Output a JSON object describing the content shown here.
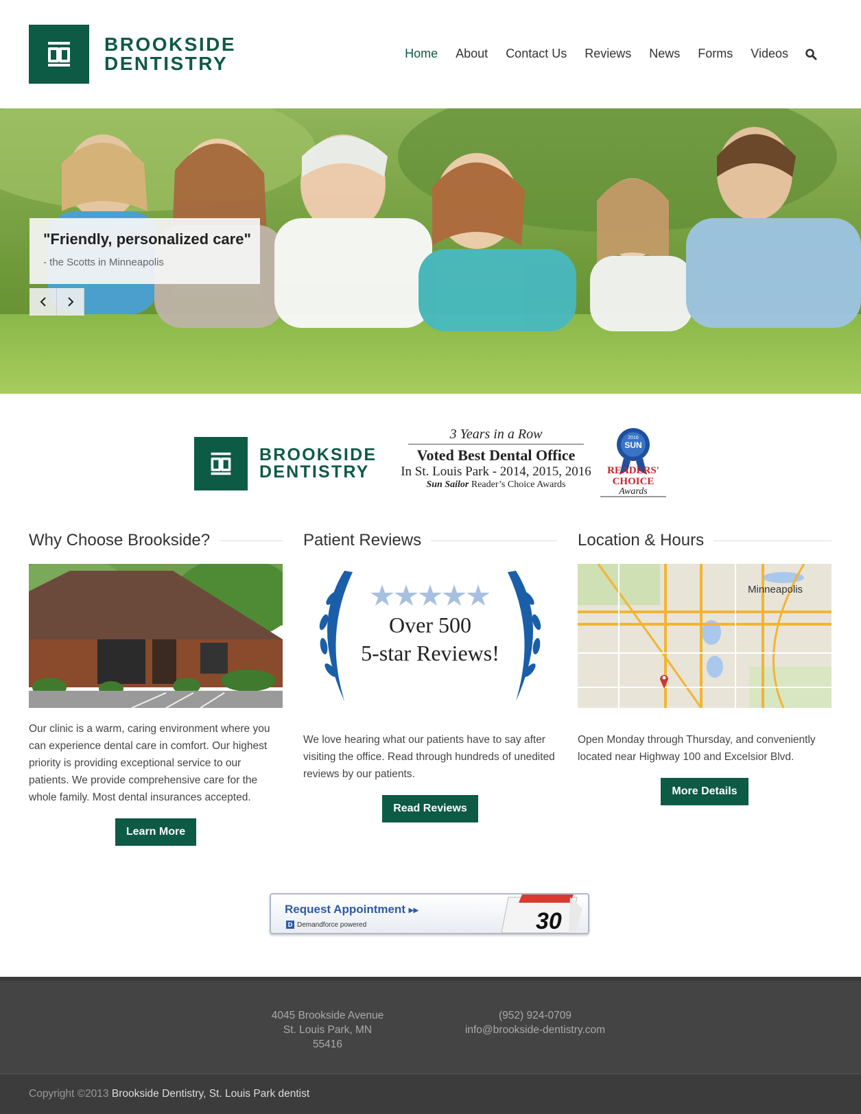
{
  "brand": {
    "name_line1": "BROOKSIDE",
    "name_line2": "DENTISTRY",
    "color": "#0d5a45"
  },
  "nav": {
    "items": [
      {
        "label": "Home",
        "active": true
      },
      {
        "label": "About"
      },
      {
        "label": "Contact Us"
      },
      {
        "label": "Reviews"
      },
      {
        "label": "News"
      },
      {
        "label": "Forms"
      },
      {
        "label": "Videos"
      }
    ],
    "search_icon": "search-icon"
  },
  "hero": {
    "quote": "\"Friendly, personalized care\"",
    "attribution": "- the Scotts in Minneapolis",
    "prev_icon": "chevron-left-icon",
    "next_icon": "chevron-right-icon"
  },
  "award": {
    "line1": "3 Years in a Row",
    "line2": "Voted Best Dental Office",
    "line3": "In St. Louis Park - 2014, 2015, 2016",
    "line4_italic": "Sun Sailor",
    "line4_rest": " Reader’s Choice Awards",
    "ribbon_year": "2016",
    "ribbon_label": "SUN",
    "ribbon_text1": "READERS'",
    "ribbon_text2": "CHOICE",
    "ribbon_text3": "Awards"
  },
  "columns": {
    "why": {
      "title": "Why Choose Brookside?",
      "text": "Our clinic is a warm, caring environment where you can experience dental care in comfort. Our highest priority is providing exceptional service to our patients. We provide comprehensive care for the whole family. Most dental insurances accepted.",
      "button": "Learn More"
    },
    "reviews": {
      "title": "Patient Reviews",
      "image_line1": "Over 500",
      "image_line2": "5-star Reviews!",
      "text": "We love hearing what our patients have to say after visiting the office. Read through hundreds of unedited reviews by our patients.",
      "button": "Read Reviews"
    },
    "location": {
      "title": "Location & Hours",
      "map_label": "Minneapolis",
      "text": "Open Monday through Thursday, and conveniently located near Highway 100 and Excelsior Blvd.",
      "button": "More Details"
    }
  },
  "request": {
    "title": "Request Appointment",
    "powered": "Demandforce powered",
    "day": "30"
  },
  "footer": {
    "address1": "4045 Brookside Avenue",
    "address2": "St. Louis Park, MN 55416",
    "phone": "(952) 924-0709",
    "email": "info@brookside-dentistry.com",
    "copyright": "Copyright ©2013 ",
    "copyright_link": "Brookside Dentistry, St. Louis Park dentist"
  }
}
